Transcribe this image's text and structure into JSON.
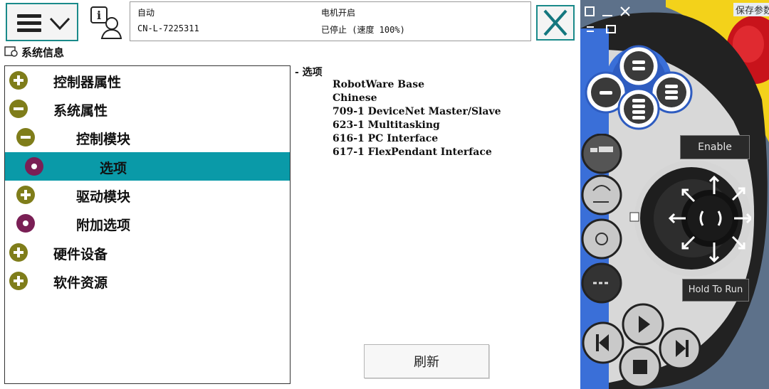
{
  "header": {
    "mode_label": "自动",
    "controller_id": "CN-L-7225311",
    "motor_label": "电机开启",
    "run_status": "已停止 (速度 100%)"
  },
  "title": "系统信息",
  "tree": [
    {
      "label": "控制器属性",
      "state": "plus"
    },
    {
      "label": "系统属性",
      "state": "minus"
    },
    {
      "label": "控制模块",
      "state": "minus"
    },
    {
      "label": "选项",
      "state": "leaf",
      "selected": true
    },
    {
      "label": "驱动模块",
      "state": "plus"
    },
    {
      "label": "附加选项",
      "state": "leaf"
    },
    {
      "label": "硬件设备",
      "state": "plus"
    },
    {
      "label": "软件资源",
      "state": "plus"
    }
  ],
  "options": {
    "header": "- 选项",
    "items": [
      "RobotWare Base",
      "Chinese",
      "709-1 DeviceNet Master/Slave",
      "623-1 Multitasking",
      "616-1 PC Interface",
      "617-1 FlexPendant Interface"
    ]
  },
  "refresh_label": "刷新",
  "pendant": {
    "enable_label": "Enable",
    "hold_label": "Hold To Run",
    "save_label": "保存参数"
  },
  "colors": {
    "accent": "#0a9aa8",
    "node_olive": "#7f7d1a",
    "node_purple": "#7a1f55",
    "pendant_blue": "#3a6fd8",
    "pendant_body": "#1f1f1f"
  }
}
